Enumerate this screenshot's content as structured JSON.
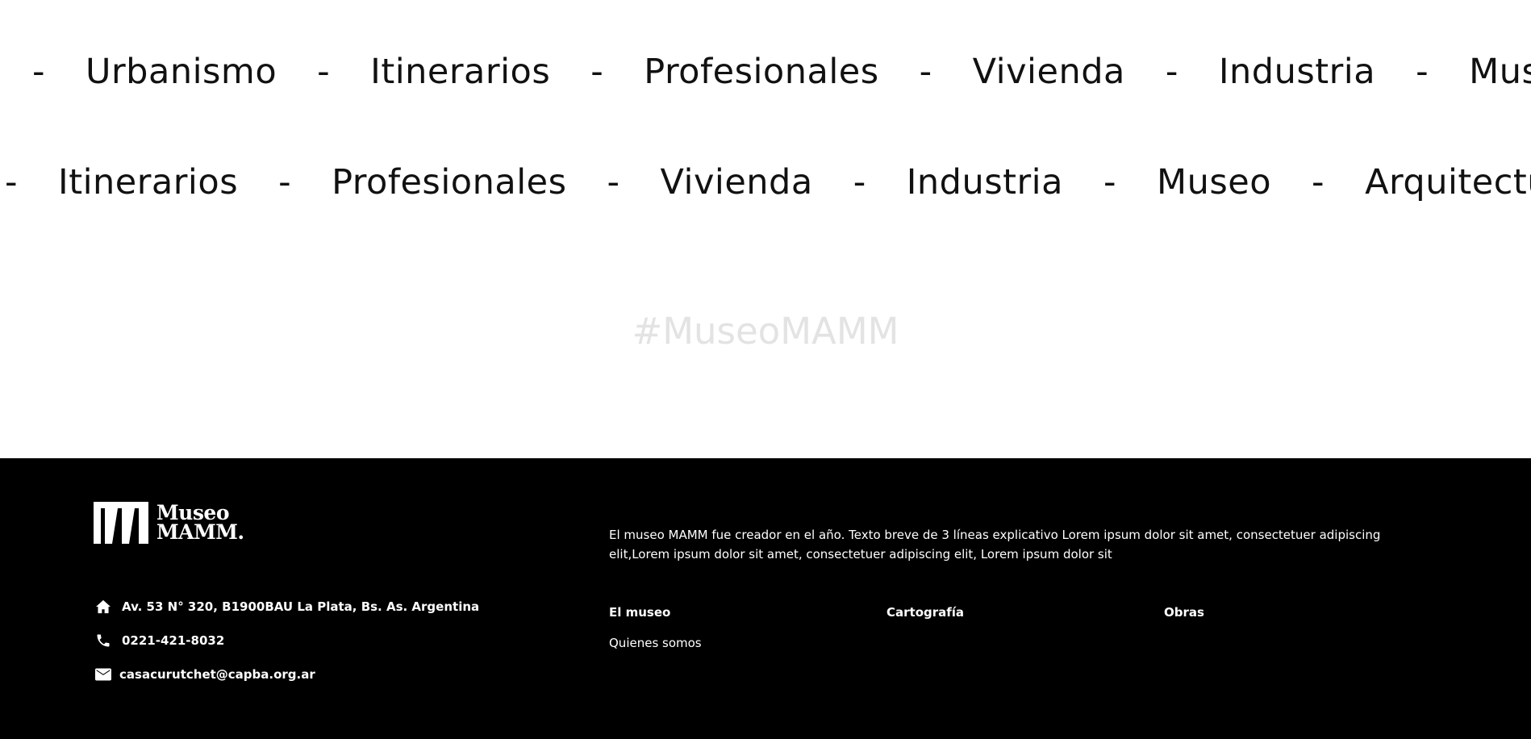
{
  "marquee_top": {
    "separator": "-",
    "items": [
      "Urbanismo",
      "Itinerarios",
      "Profesionales",
      "Vivienda",
      "Industria",
      "Museo"
    ]
  },
  "marquee_bottom": {
    "separator": "-",
    "items": [
      "Itinerarios",
      "Profesionales",
      "Vivienda",
      "Industria",
      "Museo",
      "Arquitectura"
    ]
  },
  "hashtag": "#MuseoMAMM",
  "footer": {
    "logo": {
      "line1": "Museo",
      "line2": "MAMM."
    },
    "contact": {
      "address": "Av. 53 N° 320, B1900BAU La Plata, Bs. As. Argentina",
      "phone": "0221-421-8032",
      "email": "casacurutchet@capba.org.ar"
    },
    "about": "El museo MAMM fue creador en el año. Texto breve de 3 líneas explicativo Lorem ipsum dolor sit amet, consectetuer adipiscing elit,Lorem ipsum dolor sit amet, consectetuer adipiscing elit, Lorem ipsum dolor sit",
    "columns": [
      {
        "title": "El museo",
        "links": [
          "Quienes somos"
        ]
      },
      {
        "title": "Cartografía",
        "links": []
      },
      {
        "title": "Obras",
        "links": []
      }
    ]
  },
  "colors": {
    "background": "#ffffff",
    "footer_bg": "#000000",
    "hashtag": "#e3e3e3",
    "text": "#111111"
  },
  "icons": {
    "address": "home-icon",
    "phone": "phone-icon",
    "email": "mail-icon"
  }
}
